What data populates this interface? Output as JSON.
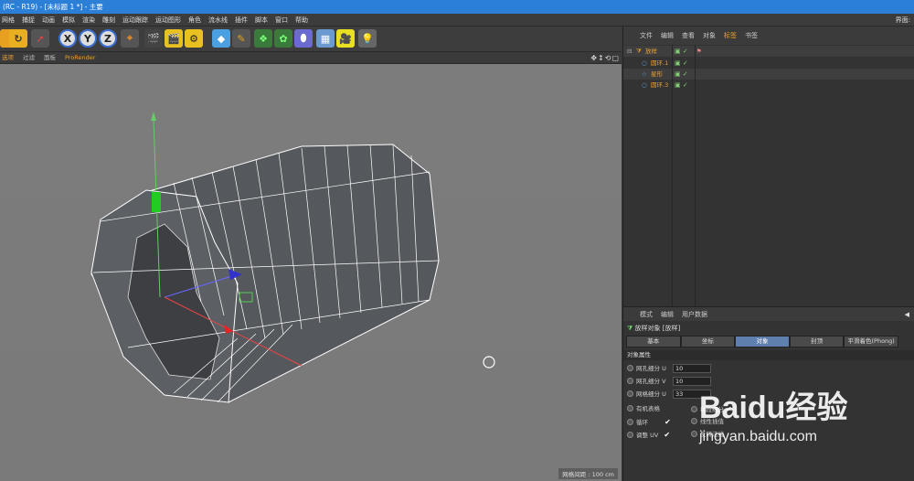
{
  "window": {
    "title": "(RC - R19) - [未标题 1 *] - 主要"
  },
  "menubar": {
    "items": [
      "网格",
      "捕捉",
      "动画",
      "模拟",
      "渲染",
      "雕刻",
      "运动跟踪",
      "运动图形",
      "角色",
      "流水线",
      "插件",
      "脚本",
      "窗口",
      "帮助"
    ],
    "right_label": "界面:"
  },
  "toolbar": {
    "axis_x": "X",
    "axis_y": "Y",
    "axis_z": "Z",
    "icons": [
      "undo-icon",
      "redo-icon",
      "select-icon",
      "x-axis-icon",
      "y-axis-icon",
      "z-axis-icon",
      "coordinate-icon",
      "render-view-icon",
      "render-picture-icon",
      "render-settings-icon",
      "cube-icon",
      "pen-icon",
      "subdivide-icon",
      "generator-icon",
      "deformer-icon",
      "floor-icon",
      "camera-icon",
      "light-icon"
    ]
  },
  "viewport_menu": {
    "items": [
      "选项",
      "过滤",
      "面板",
      "ProRender"
    ],
    "status": "网格间距 : 100 cm"
  },
  "object_manager": {
    "tabs": [
      "文件",
      "编辑",
      "查看",
      "对象",
      "标签",
      "书签"
    ],
    "active_tab": "标签",
    "objects": [
      {
        "name": "放样",
        "level": 0
      },
      {
        "name": "圆环.1",
        "level": 1
      },
      {
        "name": "星形",
        "level": 1
      },
      {
        "name": "圆环.3",
        "level": 1
      }
    ]
  },
  "attribute_manager": {
    "tabs": [
      "模式",
      "编辑",
      "用户数据"
    ],
    "object_title": "放样对象 [放样]",
    "buttons": [
      "基本",
      "坐标",
      "对象",
      "封顶",
      "平滑着色(Phong)"
    ],
    "selected_button": "对象",
    "section": "对象属性",
    "fields": [
      {
        "label": "网孔细分 U",
        "value": "10"
      },
      {
        "label": "网孔细分 V",
        "value": "10"
      },
      {
        "label": "网格细分 U",
        "value": "33"
      }
    ],
    "options": [
      {
        "label": "有机表格",
        "checked": false
      },
      {
        "label": "每段细分",
        "checked": true
      },
      {
        "label": "循环",
        "checked": true
      },
      {
        "label": "线性插值",
        "checked": false
      },
      {
        "label": "调整 UV",
        "checked": true
      },
      {
        "label": "反转法线",
        "checked": false
      }
    ]
  },
  "watermark": {
    "brand": "Baidu经验",
    "url": "jingyan.baidu.com"
  },
  "colors": {
    "titlebar": "#2b7fd6",
    "accent_orange": "#e8a030",
    "selected_button": "#5f7fae",
    "viewport": "#7b7b7b"
  }
}
